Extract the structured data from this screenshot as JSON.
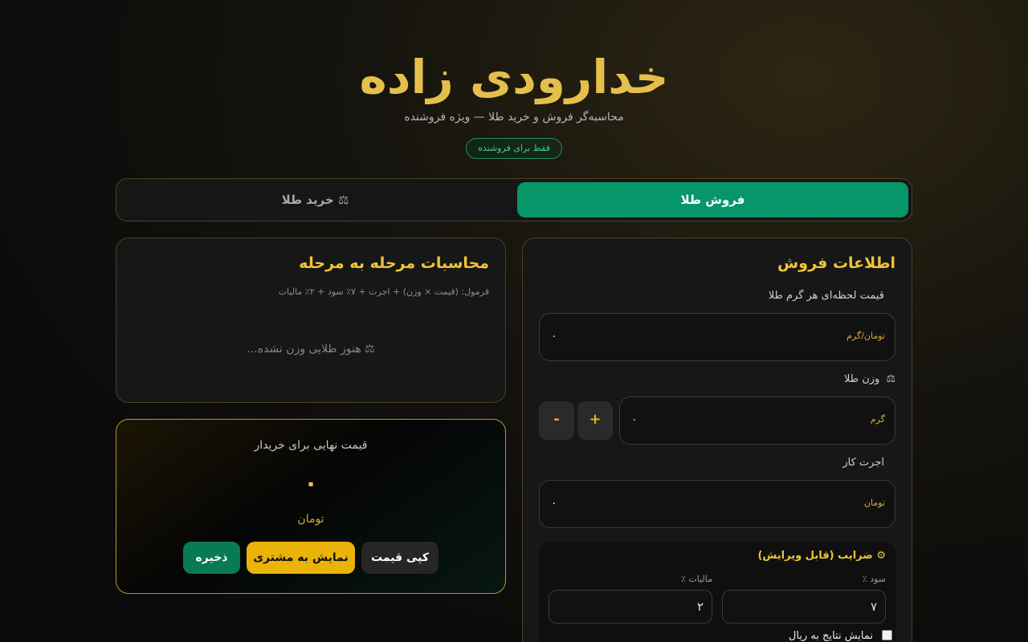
{
  "header": {
    "brand": "خدارودی زاده",
    "subtitle": "محاسبه‌گر فروش و خرید طلا — ویژه فروشنده",
    "badge": "فقط برای فروشنده"
  },
  "tabs": {
    "sell": "فروش طلا",
    "buy": "⚖ خرید طلا",
    "active": "sell"
  },
  "steps": {
    "title": "محاسبات مرحله به مرحله",
    "formula": "فرمول: (قیمت × وزن) + اجرت + ۷٪ سود + ۲٪ مالیات",
    "empty": "⚖ هنوز طلایی وزن نشده..."
  },
  "final": {
    "label": "قیمت نهایی برای خریدار",
    "value": "۰",
    "unit": "تومان",
    "copy_label": "کپی قیمت",
    "show_label": "نمایش به مشتری",
    "save_label": "ذخیره"
  },
  "form": {
    "title": "اطلاعات فروش",
    "price": {
      "label": "قیمت لحظه‌ای هر گرم طلا",
      "unit": "تومان/گرم",
      "value": "۰"
    },
    "weight": {
      "label": "وزن طلا",
      "icon": "scale-icon",
      "icon_glyph": "⚖",
      "unit": "گرم",
      "value": "۰",
      "plus": "+",
      "minus": "-"
    },
    "wage": {
      "label": "اجرت کار",
      "unit": "تومان",
      "value": "۰"
    },
    "fees": {
      "title": "⚙ ضرایب (قابل ویرایش)",
      "profit_label": "سود ٪",
      "profit_value": "۷",
      "tax_label": "مالیات ٪",
      "tax_value": "۲",
      "rial_label": "نمایش نتایج به ریال",
      "rial_checked": false
    }
  },
  "colors": {
    "gold": "#e4bf4b",
    "accent_green": "#079669",
    "yellow_button": "#eab308"
  }
}
